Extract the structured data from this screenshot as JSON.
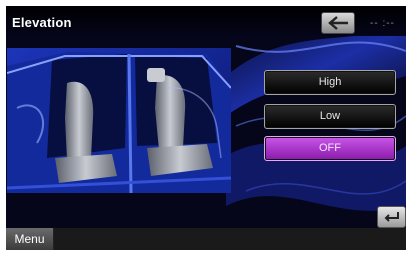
{
  "screen": {
    "title": "Elevation",
    "status_text": "-- :--"
  },
  "icons": {
    "back": "back-arrow-icon",
    "return": "return-icon"
  },
  "options": [
    {
      "label": "High",
      "selected": false
    },
    {
      "label": "Low",
      "selected": false
    },
    {
      "label": "OFF",
      "selected": true
    }
  ],
  "bottom_bar": {
    "menu_label": "Menu"
  },
  "colors": {
    "selected_option": "#b43fd6",
    "background_swirl": "#2a3fd0",
    "car_interior_blue": "#0f2aa0"
  }
}
